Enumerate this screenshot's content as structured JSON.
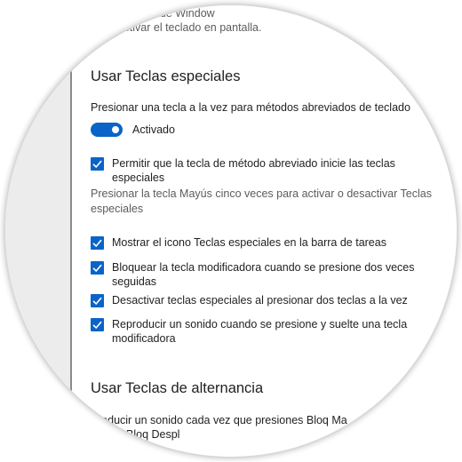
{
  "top_partial": {
    "line1": "a del logotipo de Window",
    "line2": "o desactivar el teclado en pantalla."
  },
  "sticky_keys": {
    "heading": "Usar Teclas especiales",
    "shortcut_label": "Presionar una tecla a la vez para métodos abreviados de teclado",
    "toggle_state": "Activado",
    "toggle_on": true,
    "option1_line1": "Permitir que la tecla de método abreviado inicie las teclas",
    "option1_line2": "especiales",
    "hint_line1": "Presionar la tecla Mayús cinco veces para activar o desactivar Teclas",
    "hint_line2": "especiales",
    "option2": "Mostrar el icono Teclas especiales en la barra de tareas",
    "option3_line1": "Bloquear la tecla modificadora cuando se presione dos veces",
    "option3_line2": "seguidas",
    "option4": "Desactivar teclas especiales al presionar dos teclas a la vez",
    "option5_line1": "Reproducir un sonido cuando se presione y suelte una tecla",
    "option5_line2": "modificadora"
  },
  "toggle_keys": {
    "heading": "Usar Teclas de alternancia",
    "line1": "roducir un sonido cada vez que presiones Bloq Ma",
    "line2": "Bloq Despl"
  },
  "colors": {
    "accent": "#0a64c8",
    "left_panel": "#ececec",
    "divider": "#8a8a8a"
  },
  "icons": {
    "checkbox": "checkmark-icon"
  }
}
